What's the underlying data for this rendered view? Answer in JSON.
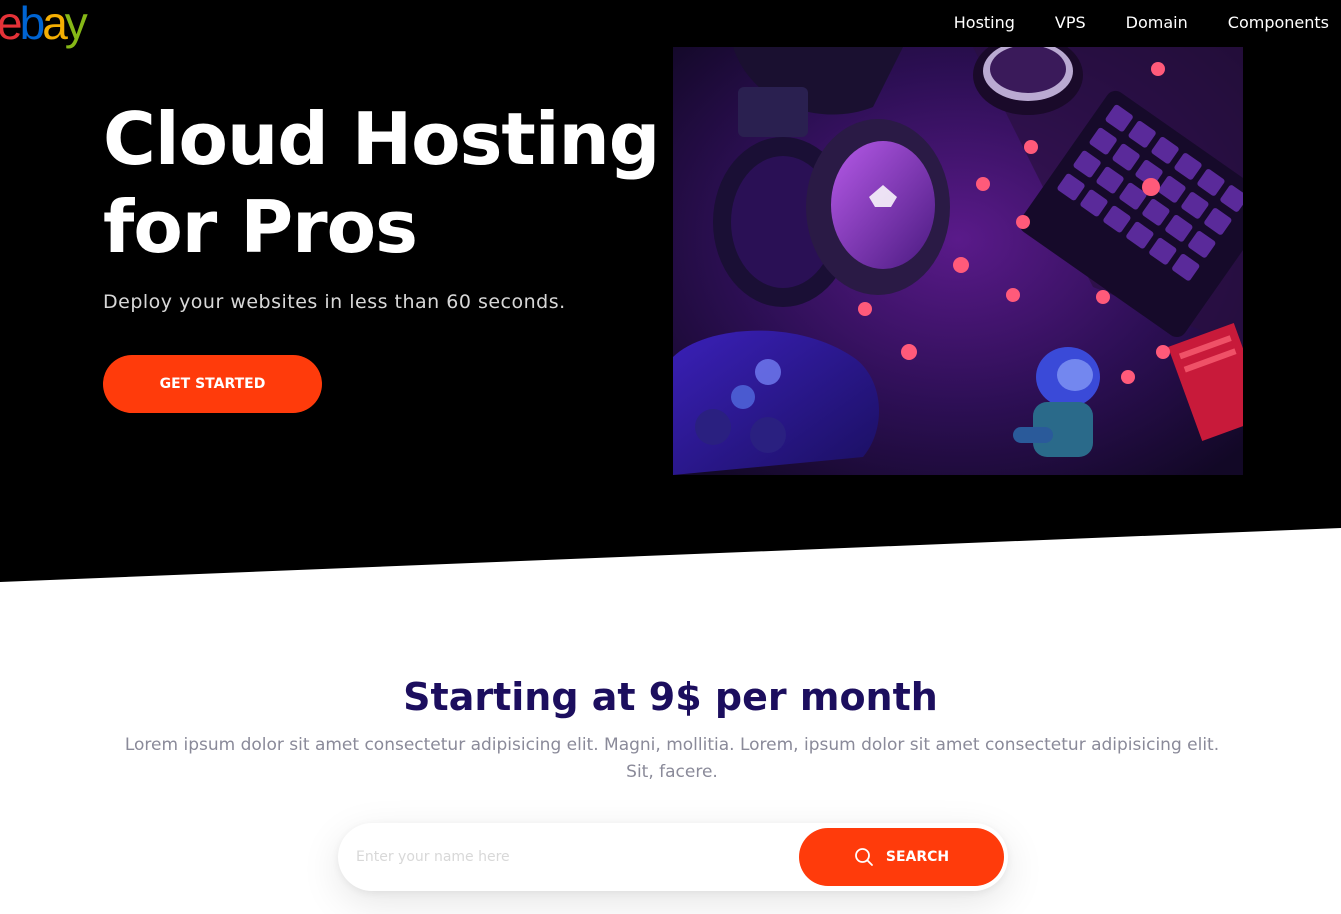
{
  "brand": {
    "logo_letters": [
      {
        "char": "e",
        "color": "#e53238"
      },
      {
        "char": "b",
        "color": "#0064d2"
      },
      {
        "char": "a",
        "color": "#f5af02"
      },
      {
        "char": "y",
        "color": "#86b817"
      }
    ]
  },
  "nav": {
    "links": [
      "Hosting",
      "VPS",
      "Domain",
      "Components"
    ]
  },
  "hero": {
    "title_line1": "Cloud Hosting",
    "title_line2": "for Pros",
    "subtitle": "Deploy your websites in less than 60 seconds.",
    "cta_label": "GET STARTED",
    "image_icon": "gaming-setup-photo"
  },
  "pricing": {
    "title": "Starting at 9$ per month",
    "description": "Lorem ipsum dolor sit amet consectetur adipisicing elit. Magni, mollitia. Lorem, ipsum dolor sit amet consectetur adipisicing elit. Sit, facere."
  },
  "search": {
    "placeholder": "Enter your name here",
    "button_label": "SEARCH",
    "button_icon": "search-icon"
  },
  "colors": {
    "accent": "#ff3b0b",
    "hero_bg": "#000000",
    "title_dark": "#1c0e5e",
    "text_muted": "#8a8a99"
  }
}
